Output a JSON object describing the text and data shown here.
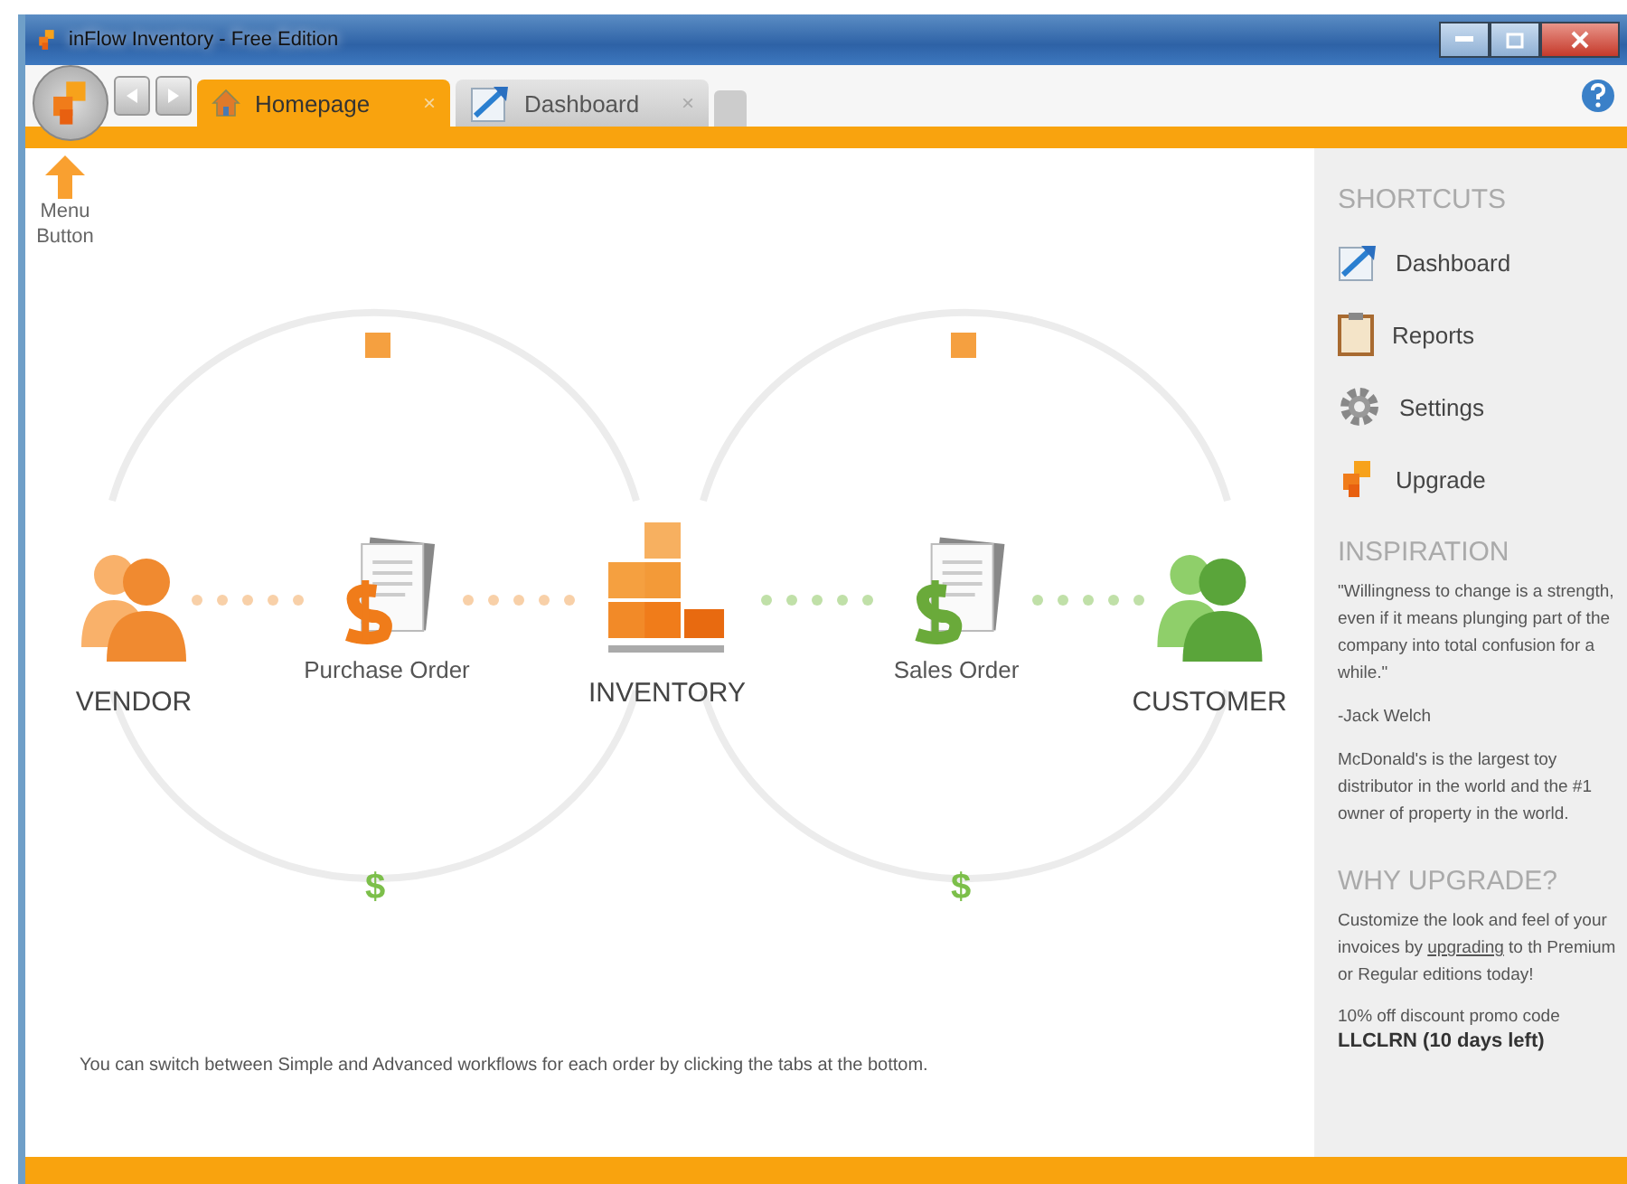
{
  "window": {
    "title": "inFlow Inventory - Free Edition"
  },
  "tabs": [
    {
      "label": "Homepage",
      "selected": true,
      "close": "×"
    },
    {
      "label": "Dashboard",
      "selected": false,
      "close": "×"
    }
  ],
  "menu_hint": {
    "label": "Menu Button"
  },
  "diagram": {
    "nodes": [
      {
        "kind": "vendor",
        "label": "VENDOR"
      },
      {
        "kind": "purchase",
        "label": "Purchase Order"
      },
      {
        "kind": "inventory",
        "label": "INVENTORY"
      },
      {
        "kind": "sales",
        "label": "Sales Order"
      },
      {
        "kind": "customer",
        "label": "CUSTOMER"
      }
    ],
    "payments": [
      "$",
      "$"
    ]
  },
  "hint": "You can switch between Simple and Advanced workflows for each order by clicking the tabs at the bottom.",
  "sidebar": {
    "shortcuts_title": "SHORTCUTS",
    "shortcuts": [
      {
        "label": "Dashboard"
      },
      {
        "label": "Reports"
      },
      {
        "label": "Settings"
      },
      {
        "label": "Upgrade"
      }
    ],
    "inspiration_title": "INSPIRATION",
    "quote": "\"Willingness to change is a strength, even if it means plunging part of the company into total confusion for a while.\"",
    "quote_author": "-Jack Welch",
    "fact": "McDonald's is the largest toy distributor in the world and the #1 owner of property in the world.",
    "upgrade_title": "WHY UPGRADE?",
    "upgrade_before": "Customize the look and feel of your invoices by ",
    "upgrade_link": "upgrading",
    "upgrade_after": " to th Premium or Regular editions today!",
    "promo": "10% off discount promo code",
    "promo_code": "LLCLRN  (10 days left)"
  }
}
